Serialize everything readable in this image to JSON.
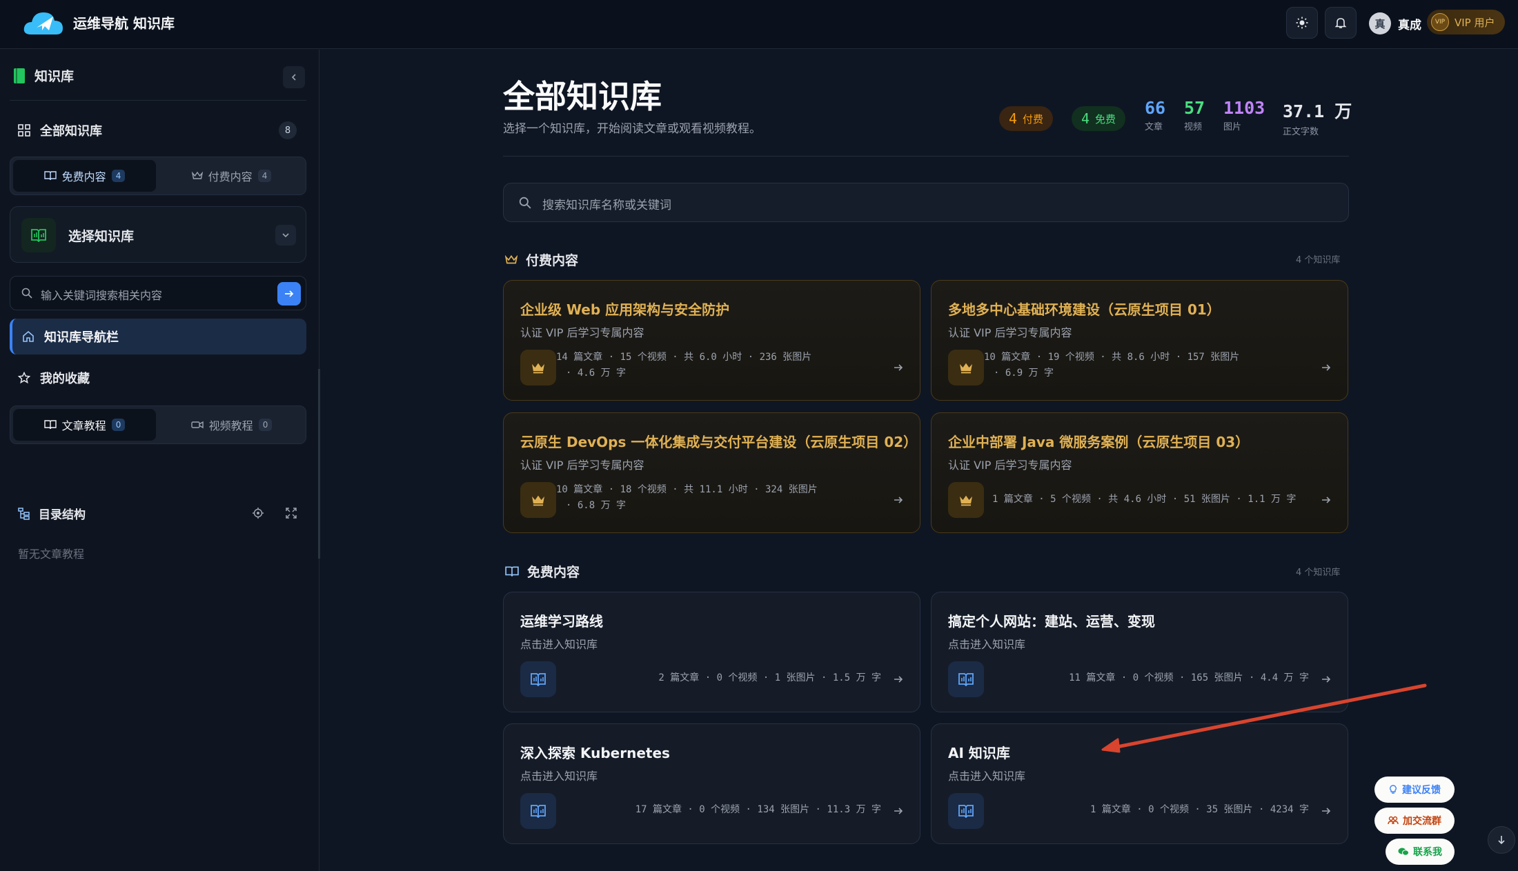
{
  "app": {
    "brand": "运维导航 知识库"
  },
  "header": {
    "user_avatar": "真",
    "user_name": "真成",
    "vip_label": "VIP 用户",
    "vip_badge": "VIP"
  },
  "sidebar": {
    "title": "知识库",
    "all_kb_label": "全部知识库",
    "all_kb_count": "8",
    "content_tabs": [
      {
        "label": "免费内容",
        "count": "4",
        "active": true
      },
      {
        "label": "付费内容",
        "count": "4",
        "active": false
      }
    ],
    "select_kb_label": "选择知识库",
    "search_placeholder": "输入关键词搜索相关内容",
    "nav_active_label": "知识库导航栏",
    "favorites_label": "我的收藏",
    "tutorial_tabs": [
      {
        "label": "文章教程",
        "count": "0",
        "active": true
      },
      {
        "label": "视频教程",
        "count": "0",
        "active": false
      }
    ],
    "toc_label": "目录结构",
    "empty_text": "暂无文章教程"
  },
  "main": {
    "title": "全部知识库",
    "subtitle": "选择一个知识库，开始阅读文章或观看视频教程。",
    "pills": [
      {
        "num": "4",
        "label": "付费"
      },
      {
        "num": "4",
        "label": "免费"
      }
    ],
    "stats": [
      {
        "value": "66",
        "label": "文章",
        "color": "#60a5fa"
      },
      {
        "value": "57",
        "label": "视频",
        "color": "#4ade80"
      },
      {
        "value": "1103",
        "label": "图片",
        "color": "#c084fc"
      },
      {
        "value": "37.1 万",
        "label": "正文字数",
        "color": "#e5e7eb"
      }
    ],
    "search_placeholder": "搜索知识库名称或关键词",
    "paid_section": {
      "title": "付费内容",
      "count": "4 个知识库",
      "cards": [
        {
          "title": "企业级 Web 应用架构与安全防护",
          "desc": "认证 VIP 后学习专属内容",
          "meta1": "14 篇文章 · 15 个视频 · 共 6.0 小时 · 236 张图片",
          "meta2": "· 4.6 万 字"
        },
        {
          "title": "多地多中心基础环境建设（云原生项目 01）",
          "desc": "认证 VIP 后学习专属内容",
          "meta1": "10 篇文章 · 19 个视频 · 共 8.6 小时 · 157 张图片",
          "meta2": "· 6.9 万 字"
        },
        {
          "title": "云原生 DevOps 一体化集成与交付平台建设（云原生项目 02）",
          "desc": "认证 VIP 后学习专属内容",
          "meta1": "10 篇文章 · 18 个视频 · 共 11.1 小时 · 324 张图片",
          "meta2": "· 6.8 万 字"
        },
        {
          "title": "企业中部署 Java 微服务案例（云原生项目 03）",
          "desc": "认证 VIP 后学习专属内容",
          "meta1": "1 篇文章 · 5 个视频 · 共 4.6 小时 · 51 张图片 · 1.1 万 字",
          "meta2": ""
        }
      ]
    },
    "free_section": {
      "title": "免费内容",
      "count": "4 个知识库",
      "cards": [
        {
          "title": "运维学习路线",
          "desc": "点击进入知识库",
          "meta": "2 篇文章 · 0 个视频 · 1 张图片 · 1.5 万 字"
        },
        {
          "title": "搞定个人网站：建站、运营、变现",
          "desc": "点击进入知识库",
          "meta": "11 篇文章 · 0 个视频 · 165 张图片 · 4.4 万 字"
        },
        {
          "title": "深入探索 Kubernetes",
          "desc": "点击进入知识库",
          "meta": "17 篇文章 · 0 个视频 · 134 张图片 · 11.3 万 字"
        },
        {
          "title": "AI 知识库",
          "desc": "点击进入知识库",
          "meta": "1 篇文章 · 0 个视频 · 35 张图片 · 4234 字"
        }
      ]
    }
  },
  "floating": [
    {
      "label": "建议反馈",
      "color": "#3b82f6"
    },
    {
      "label": "加交流群",
      "color": "#c2410c"
    },
    {
      "label": "联系我",
      "color": "#16a34a"
    }
  ],
  "colors": {
    "accent": "#3b82f6",
    "gold": "#e0b154",
    "annotation_arrow": "#d9442e"
  }
}
